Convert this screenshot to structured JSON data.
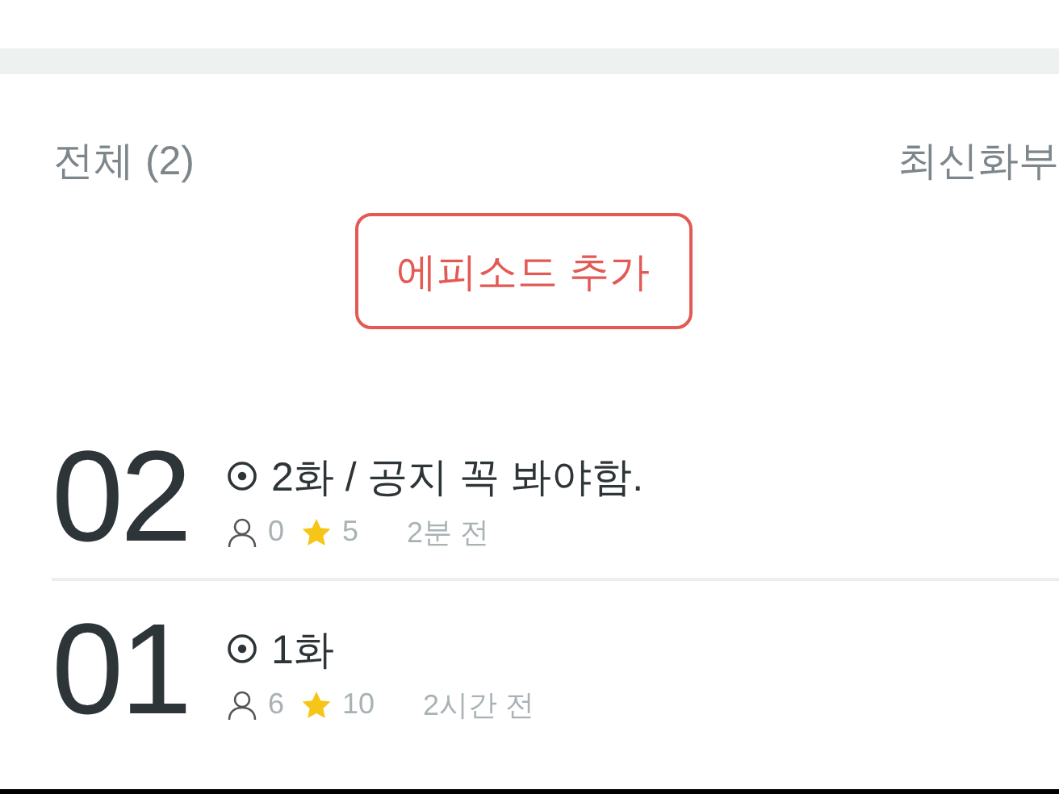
{
  "list_header": {
    "total_label": "전체 (2)",
    "sort_label": "최신화부"
  },
  "add_button": "에피소드 추가",
  "episodes": [
    {
      "number": "02",
      "title": "2화 / 공지 꼭 봐야함.",
      "viewers": "0",
      "stars_count": "5",
      "time": "2분 전"
    },
    {
      "number": "01",
      "title": "1화",
      "viewers": "6",
      "stars_count": "10",
      "time": "2시간 전"
    }
  ]
}
